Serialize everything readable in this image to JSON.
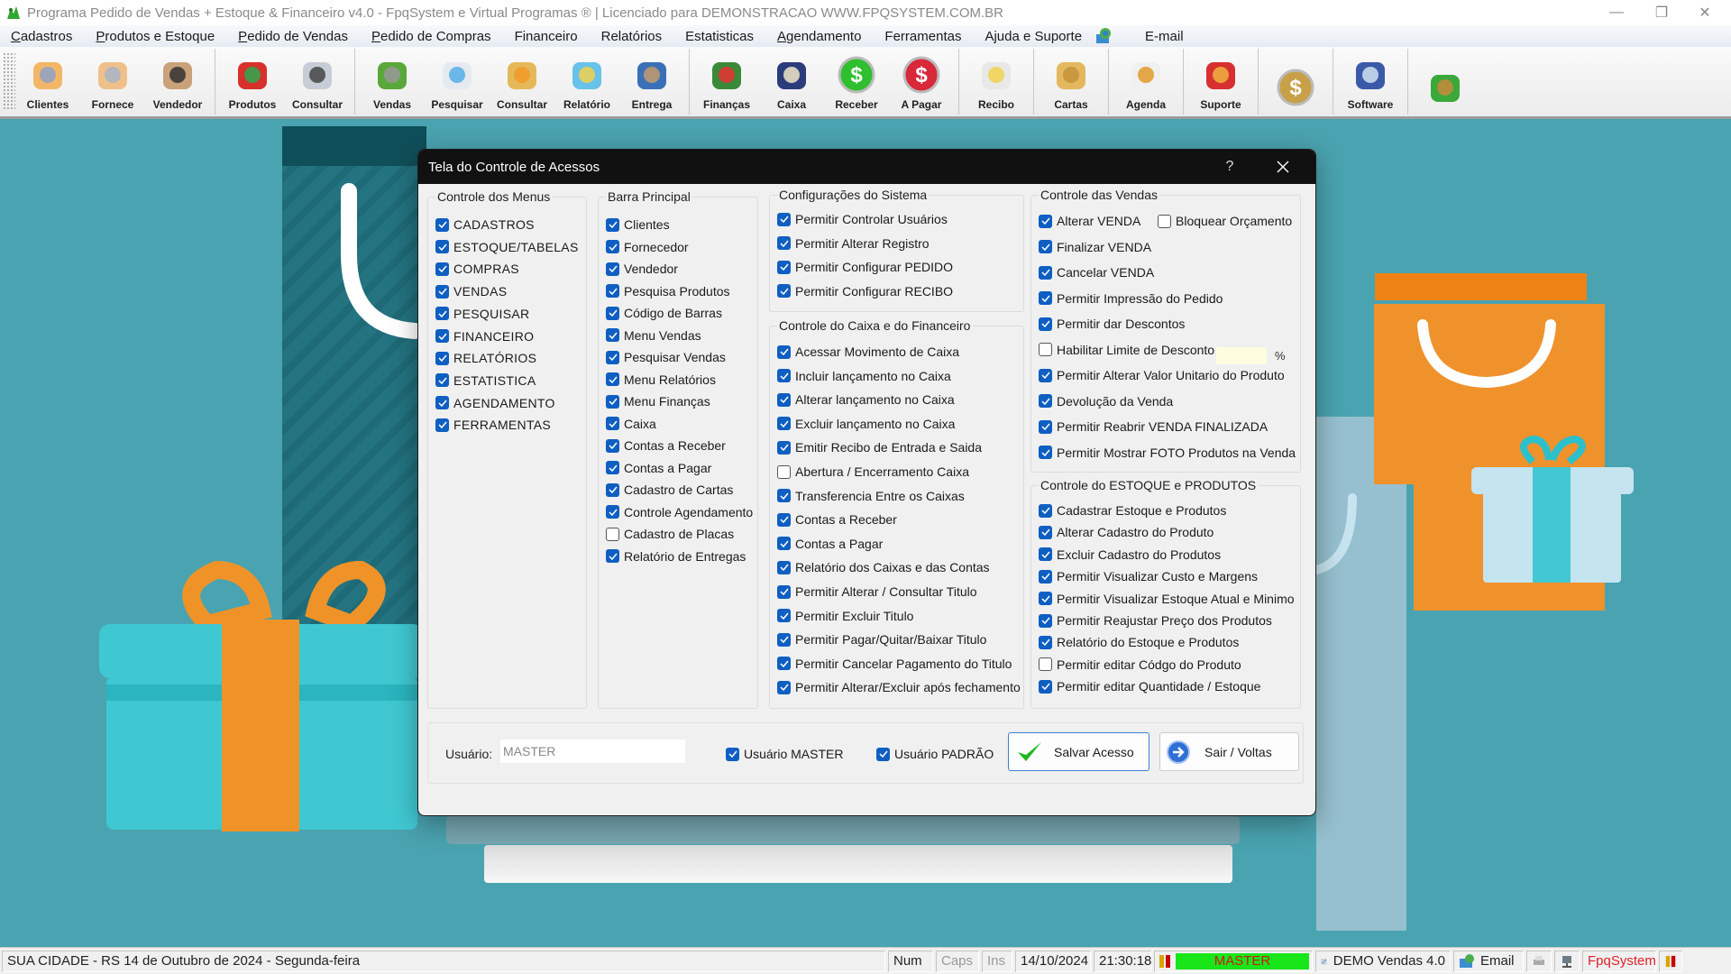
{
  "window": {
    "title": "Programa Pedido de Vendas + Estoque & Financeiro v4.0 - FpqSystem e Virtual Programas ® | Licenciado para  DEMONSTRACAO WWW.FPQSYSTEM.COM.BR",
    "controls": {
      "minimize": "—",
      "restore": "❐",
      "close": "✕"
    }
  },
  "menu": [
    {
      "label": "Cadastros",
      "accel": "C",
      "rest": "adastros"
    },
    {
      "label": "Produtos e Estoque",
      "accel": "P",
      "rest": "rodutos e Estoque"
    },
    {
      "label": "Pedido de Vendas",
      "accel": "P",
      "rest": "edido de Vendas"
    },
    {
      "label": "Pedido de Compras",
      "accel": "P",
      "rest": "edido de Compras"
    },
    {
      "label": "Financeiro",
      "accel": "",
      "rest": "Financeiro"
    },
    {
      "label": "Relatórios",
      "accel": "",
      "rest": "Relatórios"
    },
    {
      "label": "Estatisticas",
      "accel": "",
      "rest": "Estatisticas"
    },
    {
      "label": "Agendamento",
      "accel": "A",
      "rest": "gendamento"
    },
    {
      "label": "Ferramentas",
      "accel": "",
      "rest": "Ferramentas"
    },
    {
      "label": "Ajuda e Suporte",
      "accel": "",
      "rest": "Ajuda e Suporte"
    },
    {
      "label": "E-mail",
      "accel": "",
      "rest": "E-mail"
    }
  ],
  "toolbar": [
    {
      "label": "Clientes",
      "icon": "clients-icon"
    },
    {
      "label": "Fornece",
      "icon": "supplier-icon"
    },
    {
      "label": "Vendedor",
      "icon": "salesperson-icon"
    },
    {
      "sep": true
    },
    {
      "label": "Produtos",
      "icon": "products-cart-icon"
    },
    {
      "label": "Consultar",
      "icon": "barcode-icon"
    },
    {
      "sep": true
    },
    {
      "label": "Vendas",
      "icon": "shopping-cart-icon"
    },
    {
      "label": "Pesquisar",
      "icon": "search-documents-icon"
    },
    {
      "label": "Consultar",
      "icon": "file-box-icon"
    },
    {
      "label": "Relatório",
      "icon": "printer-icon"
    },
    {
      "label": "Entrega",
      "icon": "hand-truck-icon"
    },
    {
      "sep": true
    },
    {
      "label": "Finanças",
      "icon": "finance-chart-icon"
    },
    {
      "label": "Caixa",
      "icon": "cash-book-icon"
    },
    {
      "label": "Receber",
      "icon": "receive-money-icon"
    },
    {
      "label": "A Pagar",
      "icon": "pay-money-icon"
    },
    {
      "sep": true
    },
    {
      "label": "Recibo",
      "icon": "receipt-icon"
    },
    {
      "sep": true
    },
    {
      "label": "Cartas",
      "icon": "scroll-letter-icon"
    },
    {
      "sep": true
    },
    {
      "label": "Agenda",
      "icon": "calendar-clock-icon"
    },
    {
      "sep": true
    },
    {
      "label": "Suporte",
      "icon": "support-headset-icon"
    },
    {
      "sep": true
    },
    {
      "label": "",
      "icon": "coin-icon"
    },
    {
      "sep": true
    },
    {
      "label": "Software",
      "icon": "software-monitor-icon"
    },
    {
      "sep": true
    },
    {
      "label": "",
      "icon": "exit-door-icon"
    }
  ],
  "dialog": {
    "title": "Tela do Controle de Acessos",
    "help": "?",
    "groups": {
      "menus": {
        "title": "Controle dos Menus",
        "items": [
          {
            "label": "CADASTROS",
            "checked": true
          },
          {
            "label": "ESTOQUE/TABELAS",
            "checked": true
          },
          {
            "label": "COMPRAS",
            "checked": true
          },
          {
            "label": "VENDAS",
            "checked": true
          },
          {
            "label": "PESQUISAR",
            "checked": true
          },
          {
            "label": "FINANCEIRO",
            "checked": true
          },
          {
            "label": "RELATÓRIOS",
            "checked": true
          },
          {
            "label": "ESTATISTICA",
            "checked": true
          },
          {
            "label": "AGENDAMENTO",
            "checked": true
          },
          {
            "label": "FERRAMENTAS",
            "checked": true
          }
        ]
      },
      "barra": {
        "title": "Barra Principal",
        "items": [
          {
            "label": "Clientes",
            "checked": true
          },
          {
            "label": "Fornecedor",
            "checked": true
          },
          {
            "label": "Vendedor",
            "checked": true
          },
          {
            "label": "Pesquisa Produtos",
            "checked": true
          },
          {
            "label": "Código de Barras",
            "checked": true
          },
          {
            "label": "Menu Vendas",
            "checked": true
          },
          {
            "label": "Pesquisar Vendas",
            "checked": true
          },
          {
            "label": "Menu Relatórios",
            "checked": true
          },
          {
            "label": "Menu Finanças",
            "checked": true
          },
          {
            "label": "Caixa",
            "checked": true
          },
          {
            "label": "Contas a Receber",
            "checked": true
          },
          {
            "label": "Contas a Pagar",
            "checked": true
          },
          {
            "label": "Cadastro de Cartas",
            "checked": true
          },
          {
            "label": "Controle Agendamento",
            "checked": true
          },
          {
            "label": "Cadastro de Placas",
            "checked": false
          },
          {
            "label": "Relatório de Entregas",
            "checked": true
          }
        ]
      },
      "sistema": {
        "title": "Configurações do Sistema",
        "items": [
          {
            "label": "Permitir Controlar Usuários",
            "checked": true
          },
          {
            "label": "Permitir Alterar Registro",
            "checked": true
          },
          {
            "label": "Permitir Configurar PEDIDO",
            "checked": true
          },
          {
            "label": "Permitir Configurar RECIBO",
            "checked": true
          }
        ]
      },
      "caixa": {
        "title": "Controle do Caixa e do Financeiro",
        "items": [
          {
            "label": "Acessar Movimento de Caixa",
            "checked": true
          },
          {
            "label": "Incluir lançamento no Caixa",
            "checked": true
          },
          {
            "label": "Alterar lançamento no Caixa",
            "checked": true
          },
          {
            "label": "Excluir lançamento no Caixa",
            "checked": true
          },
          {
            "label": "Emitir Recibo de Entrada e Saida",
            "checked": true
          },
          {
            "label": "Abertura / Encerramento Caixa",
            "checked": false
          },
          {
            "label": "Transferencia Entre os Caixas",
            "checked": true
          },
          {
            "label": "Contas a Receber",
            "checked": true
          },
          {
            "label": "Contas a Pagar",
            "checked": true
          },
          {
            "label": "Relatório dos Caixas e das Contas",
            "checked": true
          },
          {
            "label": "Permitir Alterar / Consultar Titulo",
            "checked": true
          },
          {
            "label": "Permitir Excluir Titulo",
            "checked": true
          },
          {
            "label": "Permitir Pagar/Quitar/Baixar Titulo",
            "checked": true
          },
          {
            "label": "Permitir Cancelar Pagamento do Titulo",
            "checked": true
          },
          {
            "label": "Permitir Alterar/Excluir após fechamento",
            "checked": true
          }
        ]
      },
      "vendas": {
        "title": "Controle das Vendas",
        "items": [
          {
            "label": "Alterar VENDA",
            "checked": true
          },
          {
            "label": "Finalizar VENDA",
            "checked": true
          },
          {
            "label": "Cancelar VENDA",
            "checked": true
          },
          {
            "label": "Permitir Impressão do Pedido",
            "checked": true
          },
          {
            "label": "Permitir dar Descontos",
            "checked": true
          },
          {
            "label": "Habilitar Limite de Desconto",
            "checked": false
          },
          {
            "label": "Permitir Alterar Valor Unitario do Produto",
            "checked": true
          },
          {
            "label": "Devolução da Venda",
            "checked": true
          },
          {
            "label": "Permitir Reabrir VENDA FINALIZADA",
            "checked": true
          },
          {
            "label": "Permitir Mostrar FOTO Produtos na Venda",
            "checked": true
          }
        ],
        "bloquear": {
          "label": "Bloquear Orçamento",
          "checked": false
        },
        "limite_value": "",
        "percent": "%"
      },
      "estoque": {
        "title": "Controle do ESTOQUE e PRODUTOS",
        "items": [
          {
            "label": "Cadastrar Estoque e Produtos",
            "checked": true
          },
          {
            "label": "Alterar Cadastro do Produto",
            "checked": true
          },
          {
            "label": "Excluir Cadastro do Produtos",
            "checked": true
          },
          {
            "label": "Permitir Visualizar Custo e Margens",
            "checked": true
          },
          {
            "label": "Permitir Visualizar Estoque Atual e Minimo",
            "checked": true
          },
          {
            "label": "Permitir Reajustar Preço dos Produtos",
            "checked": true
          },
          {
            "label": "Relatório do Estoque e Produtos",
            "checked": true
          },
          {
            "label": "Permitir editar Códgo do Produto",
            "checked": false
          },
          {
            "label": "Permitir editar Quantidade / Estoque",
            "checked": true
          }
        ]
      }
    },
    "footer": {
      "user_label": "Usuário:",
      "user_value": "MASTER",
      "usuario_master": {
        "label": "Usuário MASTER",
        "checked": true
      },
      "usuario_padrao": {
        "label": "Usuário PADRÃO",
        "checked": true
      },
      "save_label": "Salvar Acesso",
      "exit_label": "Sair / Voltas"
    }
  },
  "statusbar": {
    "location_date": "SUA CIDADE - RS 14 de Outubro de 2024 - Segunda-feira",
    "num": "Num",
    "caps": "Caps",
    "ins": "Ins",
    "date": "14/10/2024",
    "time": "21:30:18",
    "user": "MASTER",
    "version": "DEMO Vendas 4.0",
    "email": "Email",
    "brand": "FpqSystem"
  },
  "colors": {
    "background": "#4aa3b0",
    "checkbox_on": "#0f5fc2",
    "status_user_bg": "#19e619",
    "status_user_text": "#d01818",
    "brand_text": "#e0202a",
    "dialog_title_bg": "#111111"
  }
}
